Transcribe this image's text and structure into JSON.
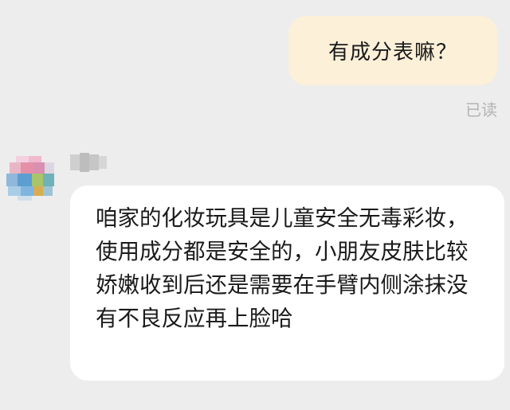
{
  "chat": {
    "sent_message": "有成分表嘛？",
    "read_status": "已读",
    "received_message": "咱家的化妆玩具是儿童安全无毒彩妆，使用成分都是安全的，小朋友皮肤比较娇嫩收到后还是需要在手臂内侧涂抹没有不良反应再上脸哈"
  },
  "colors": {
    "background": "#ededed",
    "sent_bubble": "#fcf0d8",
    "received_bubble": "#ffffff",
    "text": "#1a1a1a",
    "read_status": "#b3b3b3"
  },
  "icons": {
    "avatar": "pixelated-avatar-icon",
    "sender_name": "pixelated-name"
  }
}
